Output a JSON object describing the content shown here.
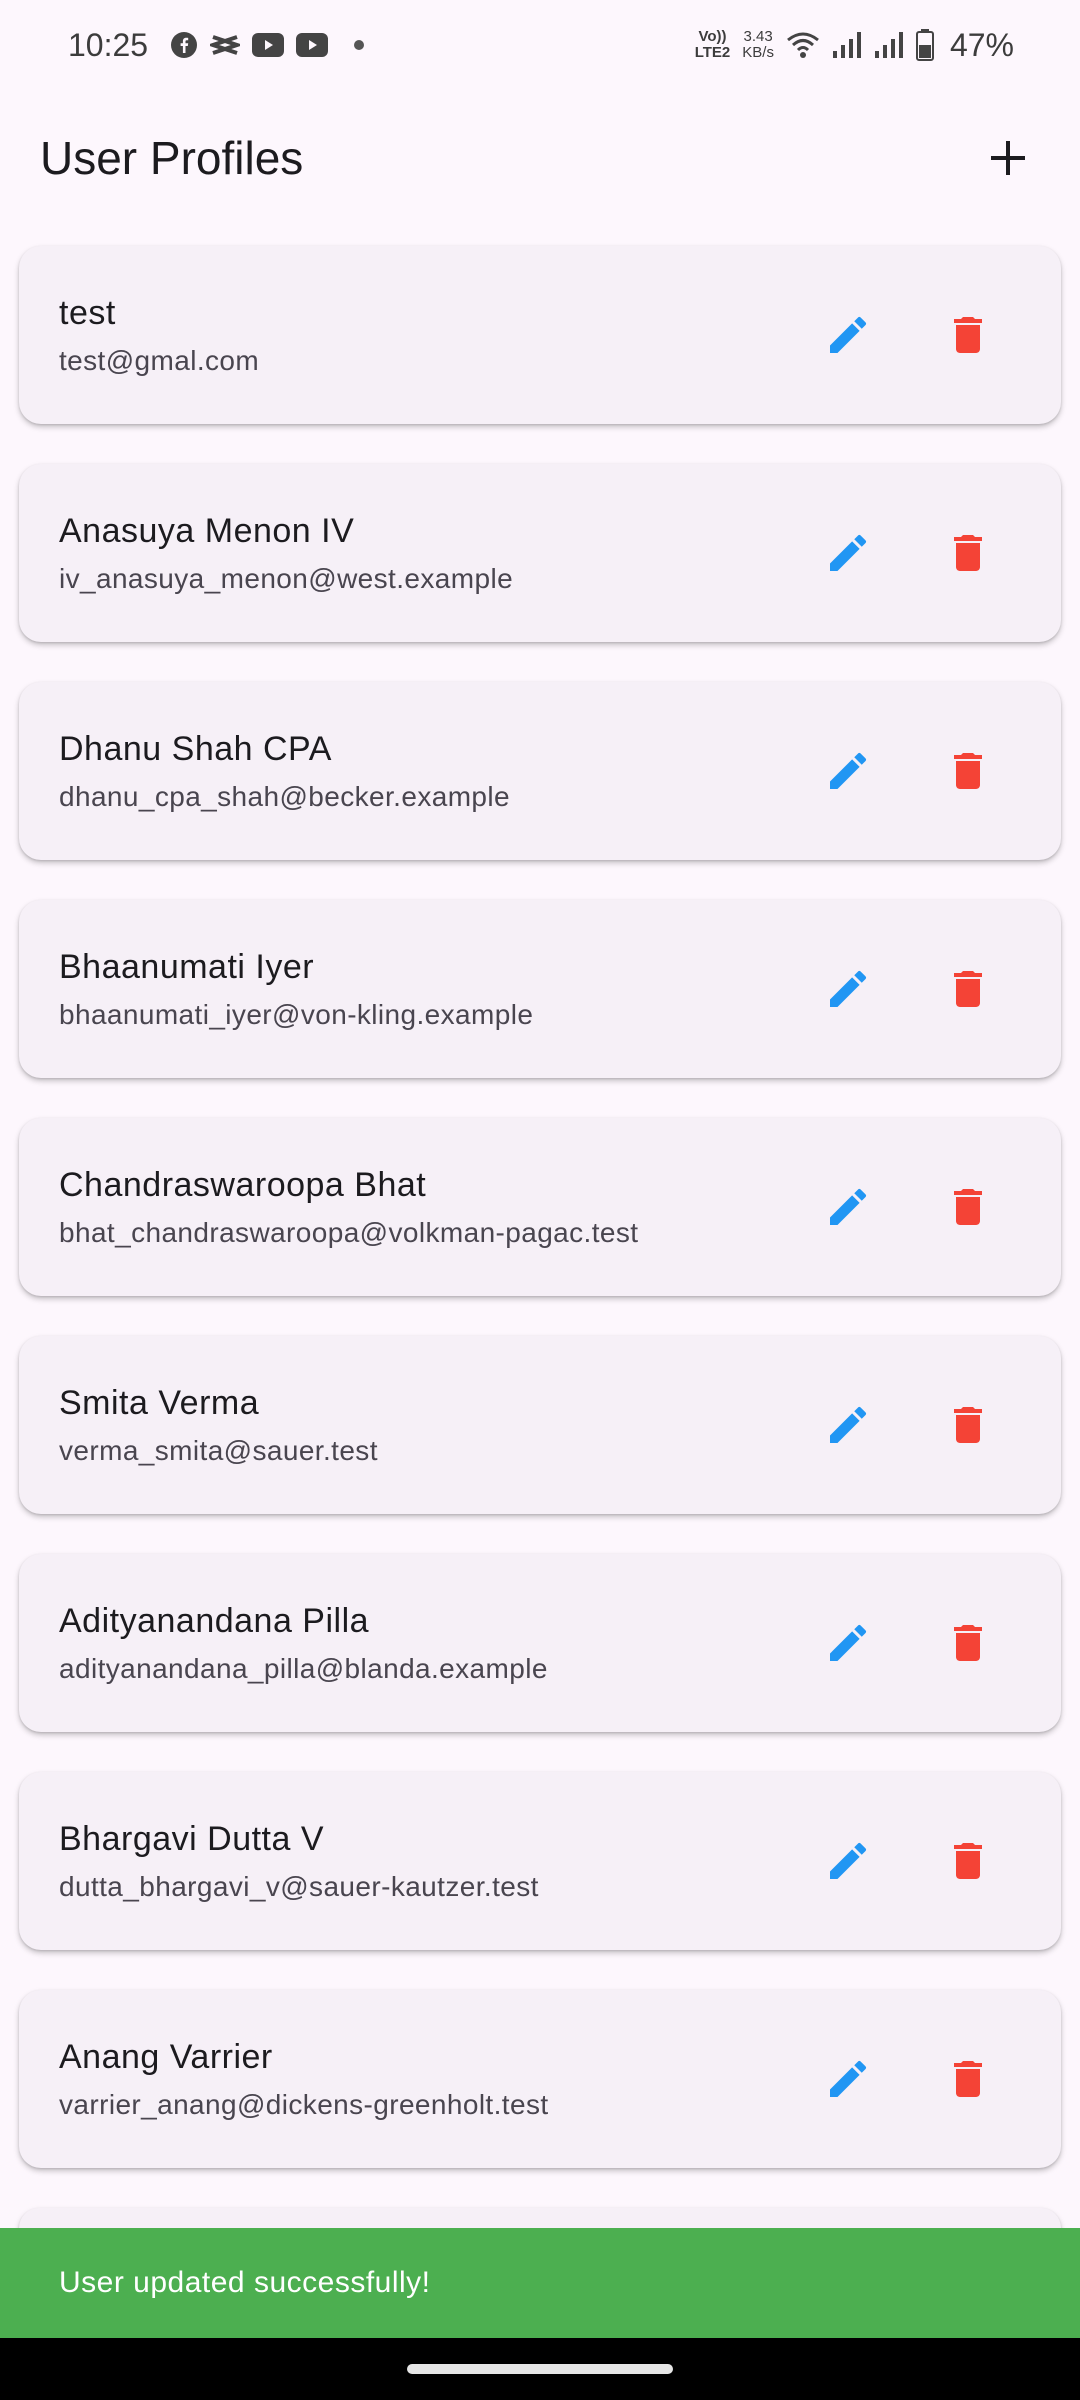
{
  "status_bar": {
    "time": "10:25",
    "notification_icons": [
      "facebook-icon",
      "capcut-icon",
      "youtube-icon",
      "youtube-icon"
    ],
    "volte_top": "Vo))",
    "volte_bottom": "LTE2",
    "speed_value": "3.43",
    "speed_unit": "KB/s",
    "battery": "47%"
  },
  "app_bar": {
    "title": "User Profiles",
    "add_icon": "plus-icon"
  },
  "colors": {
    "edit": "#2196F3",
    "delete": "#F44336",
    "snackbar": "#4CAF50",
    "card": "#F6F0F7",
    "background": "#FDF7FD"
  },
  "users": [
    {
      "name": "test",
      "email": "test@gmal.com"
    },
    {
      "name": "Anasuya Menon IV",
      "email": "iv_anasuya_menon@west.example"
    },
    {
      "name": "Dhanu Shah CPA",
      "email": "dhanu_cpa_shah@becker.example"
    },
    {
      "name": "Bhaanumati Iyer",
      "email": "bhaanumati_iyer@von-kling.example"
    },
    {
      "name": "Chandraswaroopa Bhat",
      "email": "bhat_chandraswaroopa@volkman-pagac.test"
    },
    {
      "name": "Smita Verma",
      "email": "verma_smita@sauer.test"
    },
    {
      "name": "Adityanandana Pilla",
      "email": "adityanandana_pilla@blanda.example"
    },
    {
      "name": "Bhargavi Dutta V",
      "email": "dutta_bhargavi_v@sauer-kautzer.test"
    },
    {
      "name": "Anang Varrier",
      "email": "varrier_anang@dickens-greenholt.test"
    }
  ],
  "snackbar": {
    "message": "User updated successfully!"
  }
}
